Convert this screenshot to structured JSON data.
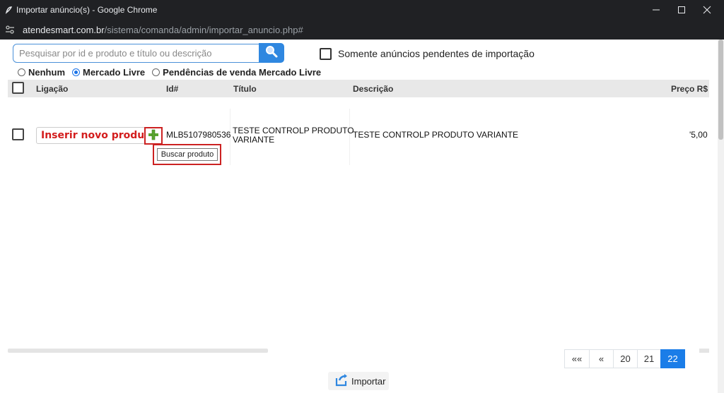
{
  "window": {
    "title": "Importar anúncio(s) - Google Chrome",
    "controls": [
      "—",
      "☐",
      "✕"
    ]
  },
  "address": {
    "host": "atendesmart.com.br",
    "path": "/sistema/comanda/admin/importar_anuncio.php#"
  },
  "search": {
    "placeholder": "Pesquisar por id e produto e título ou descrição"
  },
  "filters": {
    "pending_label": "Somente anúncios pendentes de importação",
    "radios": [
      {
        "label": "Nenhum",
        "checked": false
      },
      {
        "label": "Mercado Livre",
        "checked": true
      },
      {
        "label": "Pendências de venda Mercado Livre",
        "checked": false
      }
    ]
  },
  "table": {
    "headers": {
      "ligacao": "Ligação",
      "id": "Id#",
      "titulo": "Título",
      "descricao": "Descrição",
      "preco": "Preço R$"
    },
    "rows": [
      {
        "ligacao_btn": "Inserir novo produt",
        "tooltip": "Buscar produto",
        "id": "MLB5107980536",
        "titulo_l1": "TESTE CONTROLP PRODUTO",
        "titulo_l2": "VARIANTE",
        "descricao": "TESTE CONTROLP PRODUTO VARIANTE",
        "preco": "'5,00"
      }
    ]
  },
  "pager": {
    "first": "««",
    "prev": "«",
    "pages": [
      "20",
      "21",
      "22"
    ],
    "active": "22"
  },
  "actions": {
    "import_label": "Importar"
  },
  "colors": {
    "accent": "#2f87e0",
    "danger": "#d31d1d",
    "active_page": "#1a7de8"
  }
}
